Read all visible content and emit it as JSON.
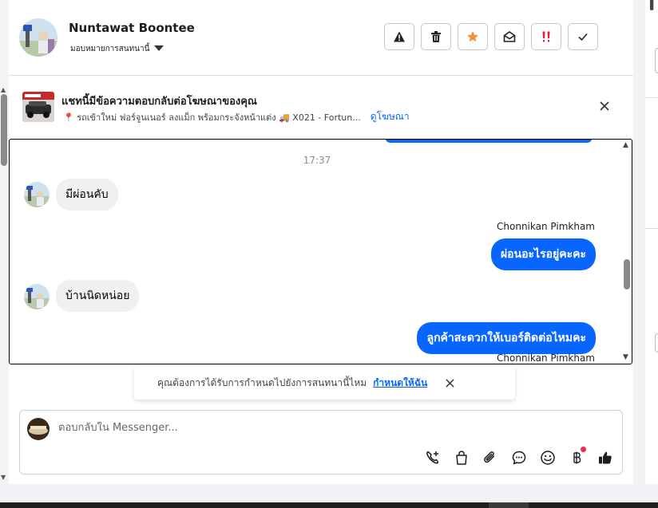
{
  "header": {
    "contact_name": "Nuntawat Boontee",
    "assign_label": "มอบหมายการสนทนานี้"
  },
  "actions": [
    {
      "name": "warning-icon"
    },
    {
      "name": "trash-icon"
    },
    {
      "name": "star-icon"
    },
    {
      "name": "mark-unread-icon"
    },
    {
      "name": "priority-icon"
    },
    {
      "name": "check-icon"
    }
  ],
  "ad_banner": {
    "title": "แชทนี้มีข้อความตอบกลับต่อโฆษณาของคุณ",
    "subtitle": "📍 รถเข้าใหม่ ฟอร์จูนเนอร์ ลงแม็ก พร้อมกระจังหน้าแต่ง 🚚 X021 - Fortun...",
    "link": "ดูโฆษณา"
  },
  "chat": {
    "timestamp": "17:37",
    "messages": [
      {
        "direction": "in",
        "text": "มีผ่อนคับ"
      },
      {
        "direction": "out",
        "sender": "Chonnikan Pimkham",
        "text": "ผ่อนอะไรอยู่คะคะ"
      },
      {
        "direction": "in",
        "text": "บ้านนิดหน่อย"
      },
      {
        "direction": "out",
        "sender": "Chonnikan Pimkham",
        "text": "ลูกค้าสะดวกให้เบอร์ติดต่อไหมคะ"
      }
    ]
  },
  "followup": {
    "text": "คุณต้องการได้รับการกำหนดไปยังการสนทนานี้ไหม",
    "link": "กำหนดให้ฉัน"
  },
  "composer": {
    "placeholder": "ตอบกลับใน Messenger..."
  },
  "toolbar_icons": [
    "phone-add-icon",
    "bag-icon",
    "paperclip-icon",
    "chat-bubble-icon",
    "emoji-icon",
    "baht-icon",
    "thumbs-up-icon"
  ],
  "colors": {
    "accent": "#0866ff",
    "priority": "#e41e3f",
    "star": "#f7923b"
  }
}
